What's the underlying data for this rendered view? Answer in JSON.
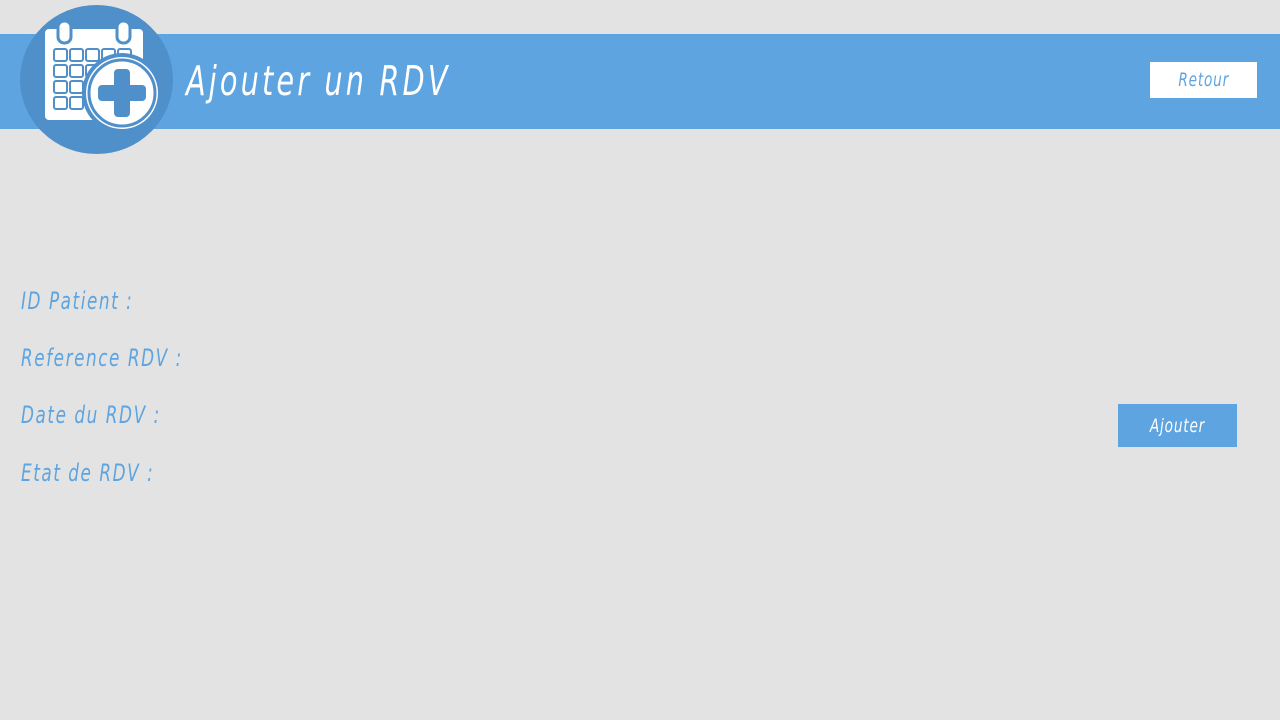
{
  "header": {
    "title": "Ajouter un RDV",
    "back_label": "Retour",
    "logo_icon": "calendar-add-icon"
  },
  "form": {
    "fields": [
      {
        "label": "ID Patient :"
      },
      {
        "label": "Reference RDV :"
      },
      {
        "label": "Date du RDV :"
      },
      {
        "label": "Etat de RDV :"
      }
    ],
    "submit_label": "Ajouter"
  },
  "colors": {
    "accent": "#5da4e0",
    "logo_circle": "#4f8fca",
    "background": "#e3e3e3",
    "white": "#ffffff"
  }
}
